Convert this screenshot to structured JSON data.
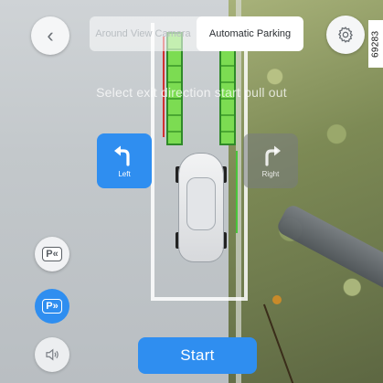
{
  "header": {
    "back_icon": "chevron-left-icon",
    "modes": [
      {
        "label": "Around View Camera",
        "active": false
      },
      {
        "label": "Automatic Parking",
        "active": true
      }
    ],
    "settings_icon": "gear-icon"
  },
  "figure_id": "69283",
  "instruction": "Select exit direction start pull out",
  "directions": {
    "left": {
      "label": "Left",
      "icon": "turn-left-arrow-icon",
      "selected": true
    },
    "right": {
      "label": "Right",
      "icon": "turn-right-arrow-icon",
      "selected": false
    }
  },
  "side_controls": {
    "park_in": {
      "label": "P«",
      "icon": "park-in-icon"
    },
    "park_out": {
      "label": "P»",
      "icon": "park-out-icon",
      "active": true
    },
    "sound": {
      "icon": "speaker-icon"
    }
  },
  "start_button": {
    "label": "Start"
  },
  "colors": {
    "accent": "#2f8ef0",
    "guide_green": "#7cdc52",
    "warning_red": "#d23030"
  }
}
